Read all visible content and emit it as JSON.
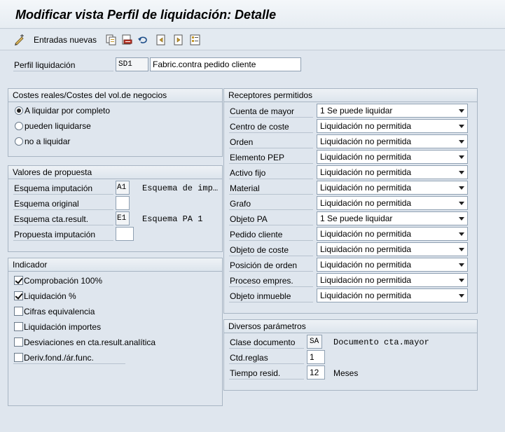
{
  "title": "Modificar vista Perfil de liquidación: Detalle",
  "toolbar": {
    "new_entries_label": "Entradas nuevas",
    "icons": [
      "edit-toggle-icon",
      "copy-icon",
      "delete-icon",
      "undo-icon",
      "previous-entry-icon",
      "next-entry-icon",
      "select-all-icon"
    ]
  },
  "profile": {
    "label": "Perfil liquidación",
    "code": "SD1",
    "description": "Fabric.contra pedido cliente"
  },
  "costes": {
    "header": "Costes reales/Costes del vol.de negocios",
    "options": [
      {
        "label": "A liquidar por completo",
        "selected": true
      },
      {
        "label": "pueden liquidarse",
        "selected": false
      },
      {
        "label": "no a liquidar",
        "selected": false
      }
    ]
  },
  "valores": {
    "header": "Valores de propuesta",
    "rows": [
      {
        "label": "Esquema imputación",
        "value": "A1",
        "desc": "Esquema de imp…"
      },
      {
        "label": "Esquema original",
        "value": "",
        "desc": ""
      },
      {
        "label": "Esquema cta.result.",
        "value": "E1",
        "desc": "Esquema PA 1"
      },
      {
        "label": "Propuesta imputación",
        "value": "",
        "desc": ""
      }
    ]
  },
  "indicador": {
    "header": "Indicador",
    "items": [
      {
        "label": "Comprobación 100%",
        "checked": true
      },
      {
        "label": "Liquidación %",
        "checked": true
      },
      {
        "label": "Cifras equivalencia",
        "checked": false
      },
      {
        "label": "Liquidación importes",
        "checked": false
      },
      {
        "label": "Desviaciones en cta.result.analítica",
        "checked": false
      },
      {
        "label": "Deriv.fond./ár.func.",
        "checked": false
      }
    ]
  },
  "receptores": {
    "header": "Receptores permitidos",
    "rows": [
      {
        "label": "Cuenta de mayor",
        "value": "1 Se puede liquidar"
      },
      {
        "label": "Centro de coste",
        "value": "Liquidación no permitida"
      },
      {
        "label": "Orden",
        "value": "Liquidación no permitida"
      },
      {
        "label": "Elemento PEP",
        "value": "Liquidación no permitida"
      },
      {
        "label": "Activo fijo",
        "value": "Liquidación no permitida"
      },
      {
        "label": "Material",
        "value": "Liquidación no permitida"
      },
      {
        "label": "Grafo",
        "value": "Liquidación no permitida"
      },
      {
        "label": "Objeto PA",
        "value": "1 Se puede liquidar"
      },
      {
        "label": "Pedido cliente",
        "value": "Liquidación no permitida"
      },
      {
        "label": "Objeto de coste",
        "value": "Liquidación no permitida"
      },
      {
        "label": "Posición de orden",
        "value": "Liquidación no permitida"
      },
      {
        "label": "Proceso empres.",
        "value": "Liquidación no permitida"
      },
      {
        "label": "Objeto inmueble",
        "value": "Liquidación no permitida"
      }
    ]
  },
  "diversos": {
    "header": "Diversos parámetros",
    "rows": [
      {
        "label": "Clase documento",
        "value": "SA",
        "desc": "Documento cta.mayor"
      },
      {
        "label": "Ctd.reglas",
        "value": "1",
        "desc": ""
      },
      {
        "label": "Tiempo resid.",
        "value": "12",
        "desc": "Meses"
      }
    ]
  },
  "colors": {
    "background": "#dfe6ee",
    "panel_border": "#a8b5c3",
    "field_border": "#8fa0b2"
  }
}
